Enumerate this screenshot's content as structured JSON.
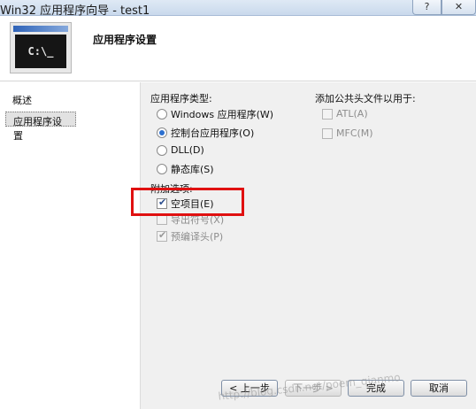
{
  "window": {
    "title": "Win32 应用程序向导 - test1",
    "help_label": "?",
    "close_label": "✕"
  },
  "header": {
    "icon_text": "C:\\_",
    "title": "应用程序设置"
  },
  "nav": {
    "items": [
      {
        "label": "概述"
      },
      {
        "label": "应用程序设置"
      }
    ]
  },
  "app_type": {
    "label": "应用程序类型:",
    "options": [
      {
        "label": "Windows 应用程序(W)",
        "selected": false
      },
      {
        "label": "控制台应用程序(O)",
        "selected": true
      },
      {
        "label": "DLL(D)",
        "selected": false
      },
      {
        "label": "静态库(S)",
        "selected": false
      }
    ]
  },
  "extra": {
    "label": "附加选项:",
    "options": [
      {
        "label": "空项目(E)",
        "checked": true,
        "enabled": true
      },
      {
        "label": "导出符号(X)",
        "checked": false,
        "enabled": false
      },
      {
        "label": "预编译头(P)",
        "checked": true,
        "enabled": false
      }
    ]
  },
  "common_headers": {
    "label": "添加公共头文件以用于:",
    "options": [
      {
        "label": "ATL(A)",
        "checked": false,
        "enabled": false
      },
      {
        "label": "MFC(M)",
        "checked": false,
        "enabled": false
      }
    ]
  },
  "buttons": {
    "prev": "< 上一步",
    "next": "下一步 >",
    "finish": "完成",
    "cancel": "取消"
  },
  "watermark": "http://blog.csdn.net/poem_qianmo",
  "colors": {
    "highlight": "#e01010",
    "radio_selected": "#2b6fcf"
  }
}
